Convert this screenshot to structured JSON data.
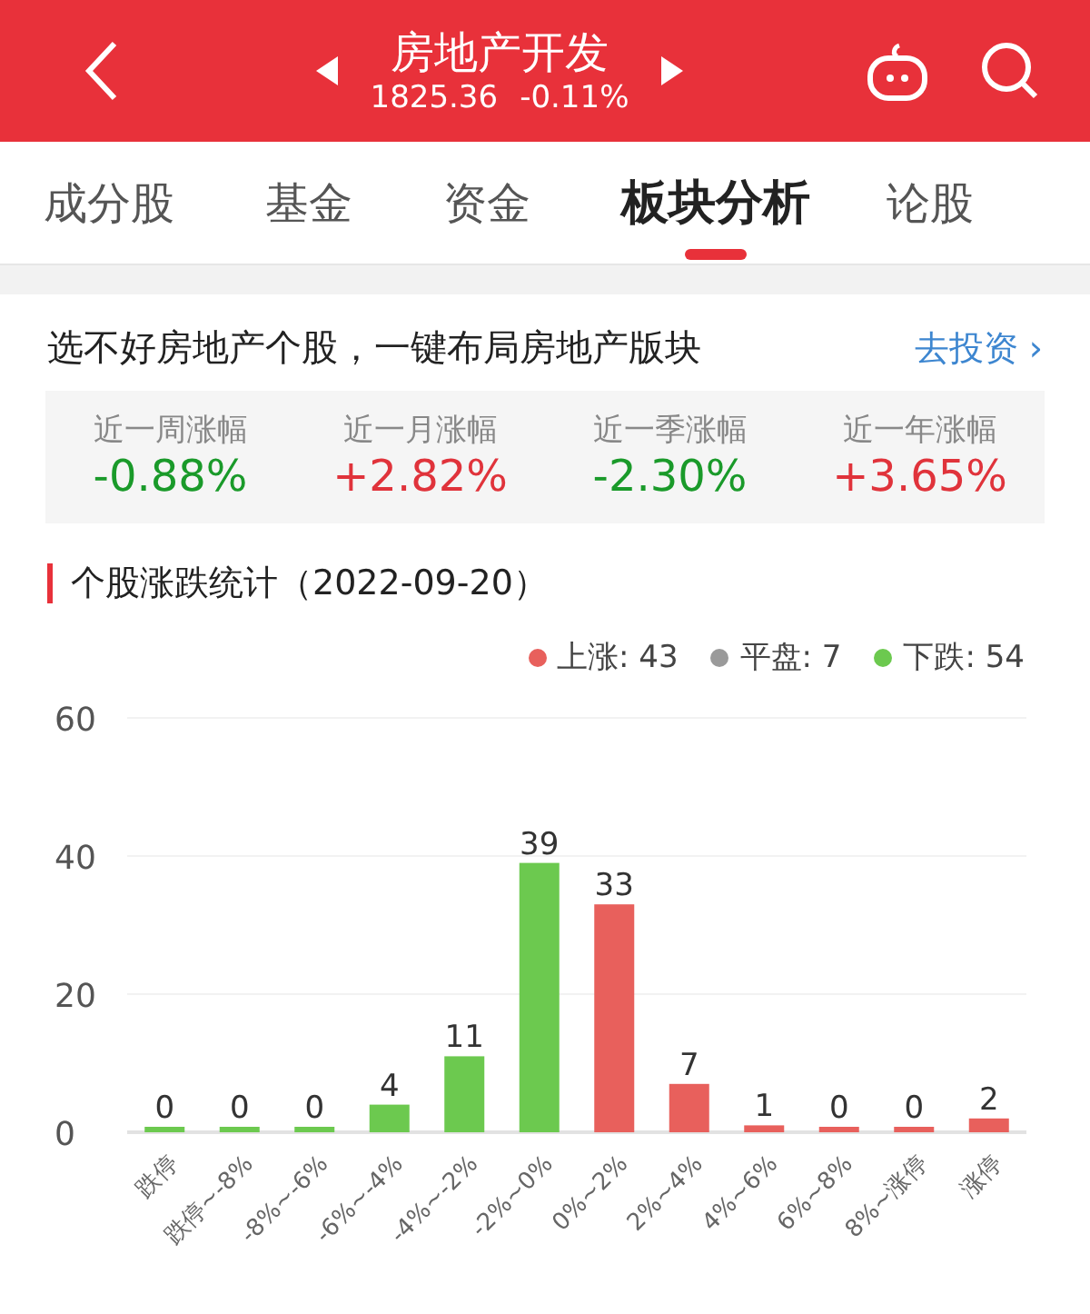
{
  "header": {
    "title": "房地产开发",
    "price": "1825.36",
    "change": "-0.11%"
  },
  "tabs": [
    {
      "label": "成分股",
      "selected": false
    },
    {
      "label": "基金",
      "selected": false
    },
    {
      "label": "资金",
      "selected": false
    },
    {
      "label": "板块分析",
      "selected": true
    },
    {
      "label": "论股",
      "selected": false
    }
  ],
  "promo": {
    "text": "选不好房地产个股，一键布局房地产版块",
    "link": "去投资",
    "chevron": "›"
  },
  "stats": [
    {
      "label": "近一周涨幅",
      "value": "-0.88%",
      "color": "#1a9a2a"
    },
    {
      "label": "近一月涨幅",
      "value": "+2.82%",
      "color": "#e0333b"
    },
    {
      "label": "近一季涨幅",
      "value": "-2.30%",
      "color": "#1a9a2a"
    },
    {
      "label": "近一年涨幅",
      "value": "+3.65%",
      "color": "#e0333b"
    }
  ],
  "section_title": "个股涨跌统计（2022-09-20）",
  "legend": [
    {
      "label": "上涨: 43",
      "color": "#e8605c"
    },
    {
      "label": "平盘: 7",
      "color": "#9a9a9a"
    },
    {
      "label": "下跌: 54",
      "color": "#6cc94f"
    }
  ],
  "chart_data": {
    "type": "bar",
    "stacked": true,
    "data_labels": true,
    "categories": [
      "跌停",
      "跌停~-8%",
      "-8%~-6%",
      "-6%~-4%",
      "-4%~-2%",
      "-2%~0%",
      "0%~2%",
      "2%~4%",
      "4%~6%",
      "6%~8%",
      "8%~涨停",
      "涨停"
    ],
    "ylim": [
      0,
      60
    ],
    "yticks": [
      0,
      20,
      40,
      60
    ],
    "series": [
      {
        "color": "#6cc94f",
        "values": [
          0,
          0,
          0,
          4,
          11,
          39,
          null,
          null,
          null,
          null,
          null,
          null
        ]
      },
      {
        "color": "#e8605c",
        "values": [
          null,
          null,
          null,
          null,
          null,
          null,
          33,
          7,
          1,
          0,
          0,
          2
        ]
      }
    ]
  }
}
